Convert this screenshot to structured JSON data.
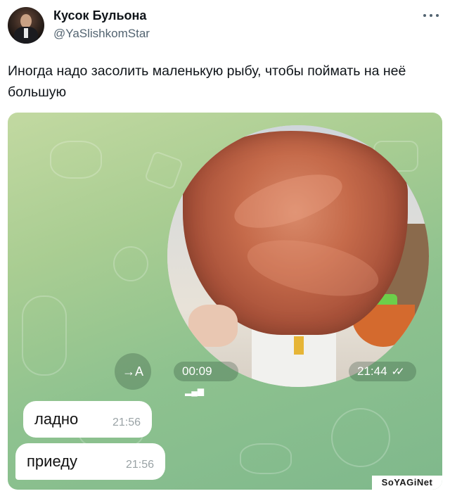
{
  "author": {
    "name": "Кусок Бульона",
    "handle": "@YaSlishkomStar"
  },
  "tweet": {
    "text": "Иногда надо засолить маленькую рыбу, чтобы поймать на неё большую"
  },
  "chat": {
    "video_message": {
      "duration": "00:09",
      "time": "21:44",
      "status_icon": "double-check-icon"
    },
    "forward_button_label": "→A",
    "messages": [
      {
        "text": "ладно",
        "time": "21:56"
      },
      {
        "text": "приеду",
        "time": "21:56"
      }
    ]
  },
  "watermark": "SoYAGiNet",
  "colors": {
    "chat_background": "#a9cd92",
    "bubble": "#ffffff",
    "handle_gray": "#536471"
  }
}
